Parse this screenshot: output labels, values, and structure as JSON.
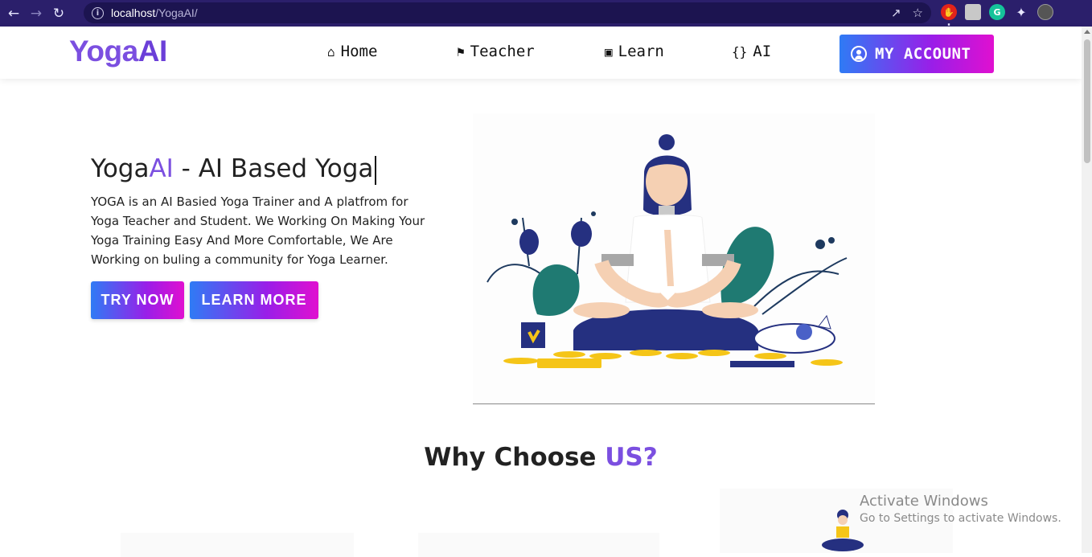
{
  "browser": {
    "url_host": "localhost",
    "url_path": "/YogaAI/"
  },
  "header": {
    "logo_part1": "Yoga",
    "logo_part2": "AI",
    "nav": [
      {
        "label": "Home",
        "icon": "home-icon"
      },
      {
        "label": "Teacher",
        "icon": "bookmark-icon"
      },
      {
        "label": "Learn",
        "icon": "portrait-icon"
      },
      {
        "label": "AI",
        "icon": "braces-icon"
      }
    ],
    "account_label": "MY ACCOUNT"
  },
  "hero": {
    "title_part1": "Yoga",
    "title_part2": "AI",
    "title_part3": " - AI Based Yoga",
    "description": "YOGA is an AI Basied Yoga Trainer and A platfrom for Yoga Teacher and Student. We Working On Making Your Yoga Training Easy And More Comfortable, We Are Working on buling a community for Yoga Learner.",
    "try_label": "TRY NOW",
    "learn_label": "LEARN MORE"
  },
  "why": {
    "title_part1": "Why Choose ",
    "title_part2": "US?"
  },
  "watermark": {
    "line1": "Activate Windows",
    "line2": "Go to Settings to activate Windows."
  },
  "colors": {
    "accent": "#7b4fe0",
    "chrome": "#2b1f6b",
    "gradient_start": "#2f7bf5",
    "gradient_end": "#e010d0"
  }
}
